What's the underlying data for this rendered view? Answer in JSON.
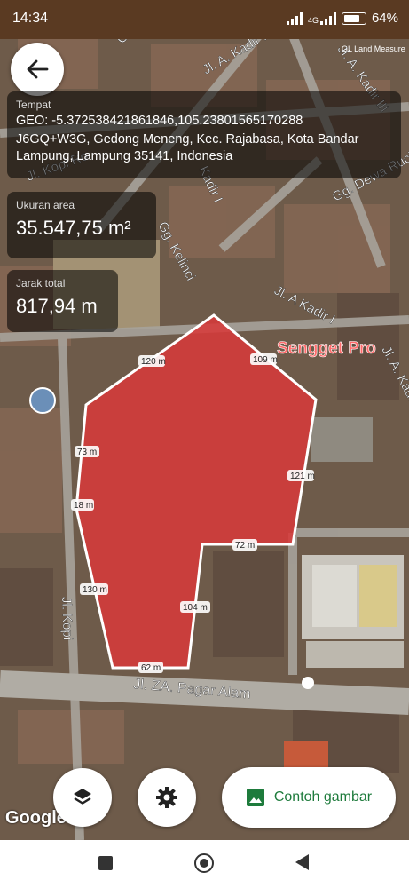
{
  "status_bar": {
    "time": "14:34",
    "network": "4G",
    "battery": "64%"
  },
  "info": {
    "place_label": "Tempat",
    "place_geo": "GEO: -5.372538421861846,105.23801565170288",
    "place_address": "J6GQ+W3G, Gedong Meneng, Kec. Rajabasa, Kota Bandar Lampung, Lampung 35141, Indonesia",
    "area_label": "Ukuran area",
    "area_value": "35.547,75 m²",
    "distance_label": "Jarak total",
    "distance_value": "817,94 m"
  },
  "map": {
    "watermark": "Sengget Pro",
    "segments": [
      "120 m",
      "109 m",
      "121 m",
      "72 m",
      "104 m",
      "62 m",
      "130 m",
      "18 m",
      "73 m"
    ],
    "streets": [
      "Jl. A. Kadir II",
      "Jl. A. Kadir III",
      "Jl. Kopi Ro",
      "Gg. Dewa Ruci",
      "Gg. Kelinci",
      "Jl. A Kadir I",
      "Jl. A. Kadir",
      "Jl. ZA. Pagar Alam",
      "Jl. Kopi",
      "Gg.",
      "Kadir I"
    ],
    "poi": "GL Land Measure",
    "google": "Google",
    "polygon_color": "#d63a3a"
  },
  "actions": {
    "sample_button": "Contoh gambar"
  }
}
